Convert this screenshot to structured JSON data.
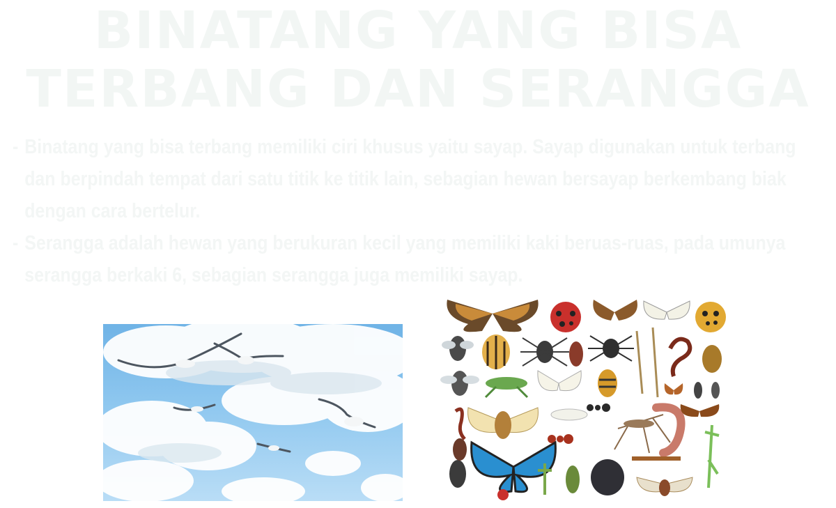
{
  "title": {
    "line1": "BINATANG YANG BISA",
    "line2": "TERBANG DAN SERANGGA"
  },
  "bullets": [
    {
      "dash": "-",
      "text": "Binatang yang bisa terbang memiliki ciri khusus yaitu sayap. Sayap digunakan untuk terbang dan berpindah tempat dari satu titik ke titik lain, sebagian hewan bersayap berkembang biak dengan cara bertelur."
    },
    {
      "dash": "-",
      "text": "Serangga adalah hewan yang berukuran kecil yang memiliki kaki beruas-ruas, pada umunya serangga berkaki 6, sebagian serangga juga memiliki sayap."
    }
  ],
  "images": {
    "sky": "birds-flying-in-sky-photo",
    "insects": "insect-collection-illustration"
  },
  "colors": {
    "title": "#f2f6f4",
    "body_text": "#f3f6f5",
    "sky_top": "#6fb3e6",
    "sky_bottom": "#b9ddf6"
  }
}
